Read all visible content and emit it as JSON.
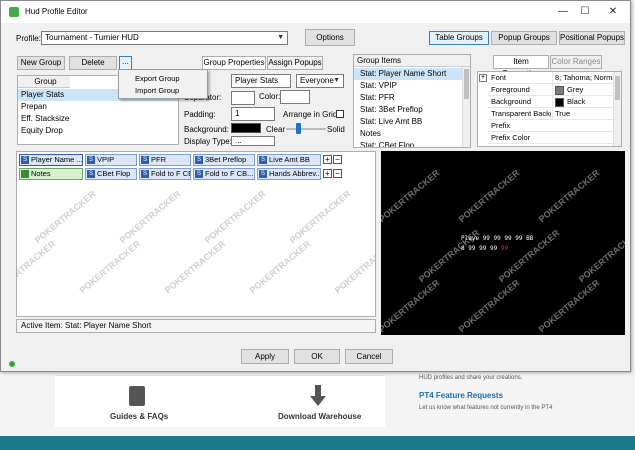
{
  "background": {
    "tile_left": "Guides & FAQs",
    "tile_right": "Download Warehouse",
    "text1": "HUD profiles and share your creations.",
    "link": "PT4 Feature Requests",
    "text2": "Let us know what features not currently in the PT4",
    "colors": {
      "band": "#1b7a8a"
    }
  },
  "window": {
    "title": "Hud Profile Editor",
    "controls": {
      "minimize": "—",
      "maximize": "☐",
      "close": "✕"
    }
  },
  "profile": {
    "label": "Profile:",
    "value": "Tournament - Turnier HUD",
    "options_button": "Options",
    "tabs": [
      "Table Groups",
      "Popup Groups",
      "Positional Popups"
    ]
  },
  "groups": {
    "new_button": "New Group",
    "delete_button": "Delete",
    "menu_button": "...",
    "header": "Group",
    "items": [
      "Player Stats",
      "Prepan",
      "Eff. Stacksize",
      "Equity Drop"
    ],
    "menu": {
      "export": "Export Group",
      "import": "Import Group"
    }
  },
  "group_props": {
    "tabs": [
      "Group Properties",
      "Assign Popups"
    ],
    "name_value": "Player Stats",
    "visibility": "Everyone",
    "separator_label": "Separator:",
    "color_label": "Color:",
    "padding_label": "Padding:",
    "padding_value": "1",
    "arrange_label": "Arrange in Grid",
    "background_label": "Background:",
    "clear_label": "Clear",
    "solid_label": "Solid",
    "display_type_label": "Display Type:",
    "display_type_value": "...",
    "opacity_percent": 30
  },
  "group_items": {
    "header": "Group Items",
    "items": [
      "Stat: Player Name Short",
      "Stat: VPIP",
      "Stat: PFR",
      "Stat: 3Bet Preflop",
      "Stat: Live Amt BB",
      "Notes",
      "Stat: CBet Flop"
    ]
  },
  "item_props": {
    "tabs": [
      "Item Properties",
      "Color Ranges"
    ],
    "rows": [
      {
        "key": "Font",
        "value": "8; Tahoma; Norma"
      },
      {
        "key": "Foreground",
        "value": "Grey",
        "swatch": "#7a7a7a"
      },
      {
        "key": "Background",
        "value": "Black",
        "swatch": "#000000"
      },
      {
        "key": "Transparent Backg",
        "value": "True"
      },
      {
        "key": "Prefix",
        "value": ""
      },
      {
        "key": "Prefix Color",
        "value": ""
      }
    ],
    "expand": "+"
  },
  "layout_grid": {
    "row1": [
      "Player Name ...",
      "VPIP",
      "PFR",
      "3Bet Preflop",
      "Live Amt BB"
    ],
    "row2": [
      "Notes",
      "CBet Flop",
      "Fold to F CB...",
      "Fold to F CB...",
      "Hands Abbrev..."
    ],
    "stat_icon": "S",
    "plus": "+",
    "minus": "−",
    "watermark": "POKERTRACKER"
  },
  "active_item": "Active Item: Stat: Player Name Short",
  "preview": {
    "line1_label": "Playe",
    "line1_values": [
      "99",
      "99",
      "99",
      "99",
      "BB"
    ],
    "line2_label": "8",
    "line2_values": [
      "99",
      "99",
      "99",
      "99"
    ],
    "highlight_color": "#e03030",
    "watermark": "POKERTRACKER"
  },
  "buttons": {
    "apply": "Apply",
    "ok": "OK",
    "cancel": "Cancel"
  }
}
